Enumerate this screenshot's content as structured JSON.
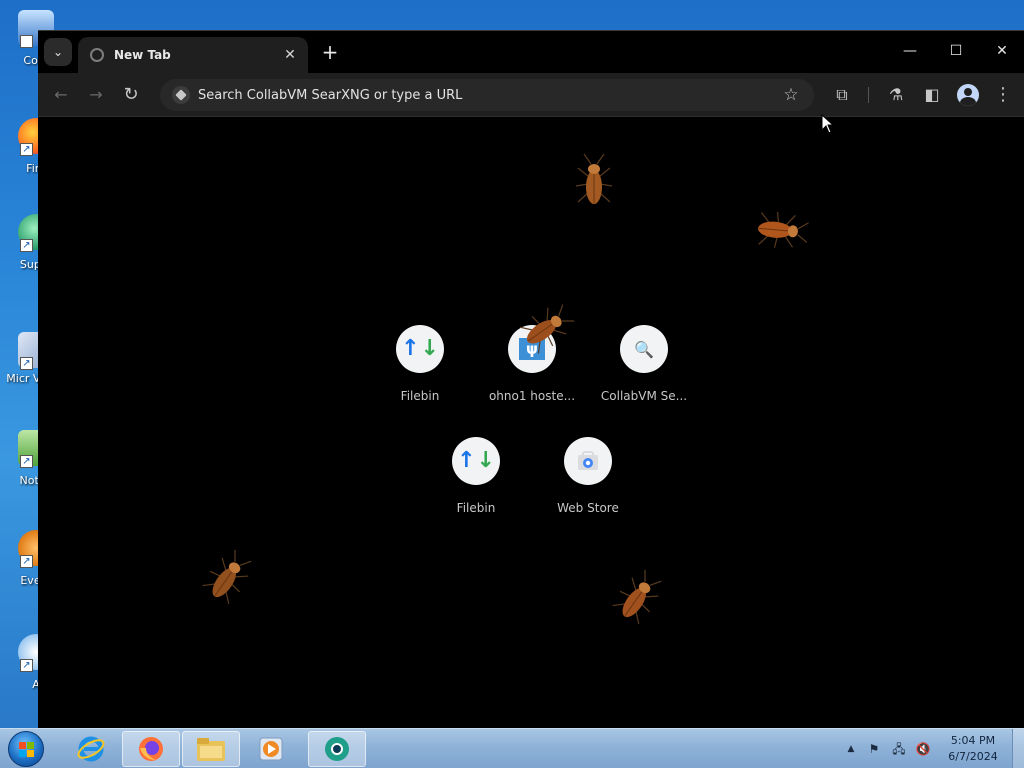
{
  "desktop": {
    "icons": [
      {
        "label": "Com",
        "icon": "computer-icon"
      },
      {
        "label": "Fire",
        "icon": "firefox-icon"
      },
      {
        "label": "Super",
        "icon": "supertux-icon"
      },
      {
        "label": "Micr Visual",
        "icon": "visual-studio-icon"
      },
      {
        "label": "Notep",
        "icon": "notepad-icon"
      },
      {
        "label": "Every",
        "icon": "everything-icon"
      },
      {
        "label": "A",
        "icon": "app-icon"
      }
    ]
  },
  "browser": {
    "tab": {
      "title": "New Tab",
      "close_glyph": "✕"
    },
    "new_tab_glyph": "+",
    "tab_search_glyph": "⌄",
    "window_controls": {
      "minimize": "—",
      "maximize": "☐",
      "close": "✕"
    },
    "toolbar": {
      "back_glyph": "←",
      "forward_glyph": "→",
      "reload_glyph": "↻",
      "omnibox_placeholder": "Search CollabVM SearXNG or type a URL",
      "bookmark_glyph": "☆",
      "extensions_glyph": "⧉",
      "labs_glyph": "⚗",
      "side_panel_glyph": "◧",
      "menu_glyph": "⋮"
    },
    "shortcuts": [
      {
        "label": "Filebin",
        "icon": "filebin-icon"
      },
      {
        "label": "ohno1 hoste...",
        "icon": "ohno1-icon",
        "glyph": "ψ"
      },
      {
        "label": "CollabVM Se...",
        "icon": "collabvm-search-icon",
        "glyph": "🔍"
      },
      {
        "label": "Filebin",
        "icon": "filebin-icon"
      },
      {
        "label": "Web Store",
        "icon": "web-store-icon"
      }
    ]
  },
  "taskbar": {
    "apps": [
      {
        "name": "internet-explorer",
        "active": false
      },
      {
        "name": "firefox",
        "active": true
      },
      {
        "name": "file-explorer",
        "active": true
      },
      {
        "name": "media-player",
        "active": false
      },
      {
        "name": "chrome-beta",
        "active": true
      }
    ],
    "clock": {
      "time": "5:04 PM",
      "date": "6/7/2024"
    },
    "tray": {
      "show_hidden_glyph": "▲",
      "flag_glyph": "⚑",
      "network_glyph": "🖧",
      "volume_glyph": "🔇"
    }
  },
  "colors": {
    "accent_blue": "#1a73e8",
    "accent_green": "#34a853",
    "toolbar_bg": "#1f1f1f",
    "page_bg": "#000000"
  }
}
